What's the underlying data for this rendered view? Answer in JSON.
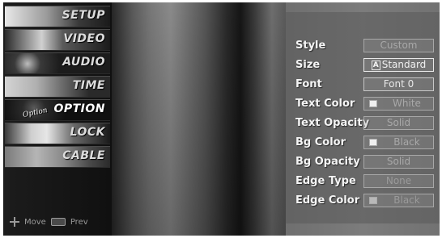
{
  "menu": {
    "items": [
      {
        "label": "SETUP"
      },
      {
        "label": "VIDEO"
      },
      {
        "label": "AUDIO"
      },
      {
        "label": "TIME"
      },
      {
        "label": "OPTION",
        "tag": "Option"
      },
      {
        "label": "LOCK"
      },
      {
        "label": "CABLE"
      }
    ],
    "footer": {
      "move_label": "Move",
      "prev_label": "Prev"
    }
  },
  "captions": {
    "rows": [
      {
        "label": "Style",
        "value": "Custom"
      },
      {
        "label": "Size",
        "value_glyph": "A",
        "value": "Standard"
      },
      {
        "label": "Font",
        "value": "Font  0"
      },
      {
        "label": "Text Color",
        "value": "White",
        "swatch": "#f0f0f0"
      },
      {
        "label": "Text Opacity",
        "value": "Solid"
      },
      {
        "label": "Bg Color",
        "value": "Black",
        "swatch": "#f0f0f0"
      },
      {
        "label": "Bg Opacity",
        "value": "Solid"
      },
      {
        "label": "Edge Type",
        "value": "None"
      },
      {
        "label": "Edge Color",
        "value": "Black",
        "swatch": "#b8b8b8"
      }
    ]
  }
}
